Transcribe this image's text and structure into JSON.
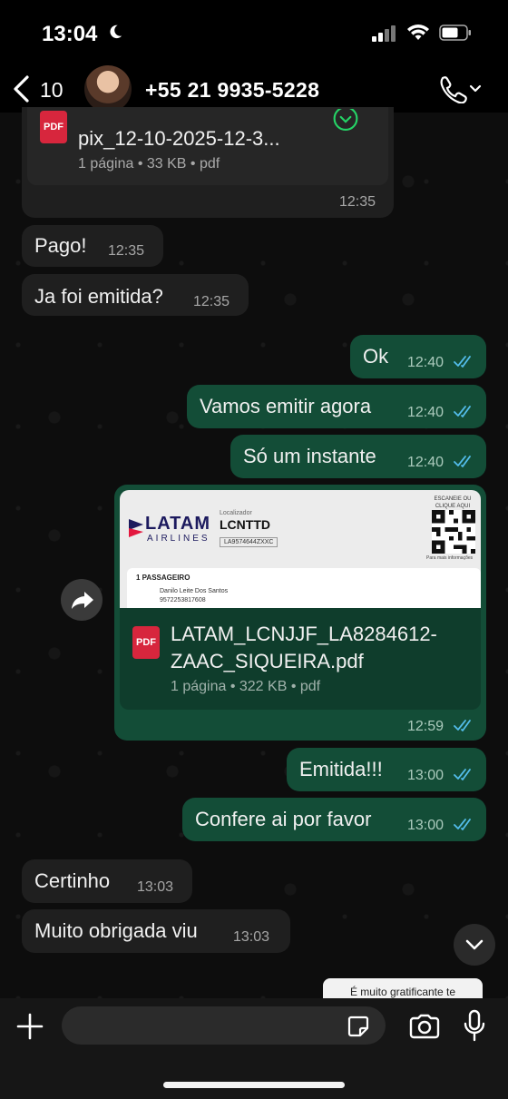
{
  "status_bar": {
    "time": "13:04",
    "icons": [
      "moon-icon",
      "signal-icon",
      "wifi-icon",
      "battery-icon"
    ]
  },
  "header": {
    "back_count": "10",
    "contact_name": "+55 21 9935-5228",
    "icons": [
      "chevron-left-icon",
      "avatar",
      "phone-icon",
      "chevron-down-icon"
    ]
  },
  "messages": [
    {
      "type": "document",
      "direction": "in",
      "badge": "PDF",
      "title": "pix_12-10-2025-12-3...",
      "meta": "1 página • 33 KB • pdf",
      "time": "12:35"
    },
    {
      "type": "text",
      "direction": "in",
      "text": "Pago!",
      "time": "12:35"
    },
    {
      "type": "text",
      "direction": "in",
      "text": "Ja foi emitida?",
      "time": "12:35"
    },
    {
      "type": "text",
      "direction": "out",
      "text": "Ok",
      "time": "12:40",
      "status": "read"
    },
    {
      "type": "text",
      "direction": "out",
      "text": "Vamos emitir agora",
      "time": "12:40",
      "status": "read"
    },
    {
      "type": "text",
      "direction": "out",
      "text": "Só um instante",
      "time": "12:40",
      "status": "read"
    },
    {
      "type": "document",
      "direction": "out",
      "badge": "PDF",
      "title_line1": "LATAM_LCNJJF_LA8284612-",
      "title_line2": "ZAAC_SIQUEIRA.pdf",
      "meta": "1 página • 322 KB • pdf",
      "time": "12:59",
      "status": "read",
      "preview": {
        "brand": "LATAM",
        "brand_sub": "AIRLINES",
        "locator_label": "Localizador",
        "locator_code": "LCNTTD",
        "locator_sub": "LA9574644ZXXC",
        "qr_label": "ESCANEIE OU CLIQUE AQUI",
        "qr_foot": "Para mais informações",
        "passengers_title": "1 PASSAGEIRO",
        "passenger_name": "Danilo Leite Dos Santos",
        "passenger_id": "9572253817608"
      }
    },
    {
      "type": "text",
      "direction": "out",
      "text": "Emitida!!!",
      "time": "13:00",
      "status": "read"
    },
    {
      "type": "text",
      "direction": "out",
      "text": "Confere ai por favor",
      "time": "13:00",
      "status": "read"
    },
    {
      "type": "text",
      "direction": "in",
      "text": "Certinho",
      "time": "13:03"
    },
    {
      "type": "text",
      "direction": "in",
      "text": "Muito obrigada viu",
      "time": "13:03"
    }
  ],
  "partial_reply_preview": "É muito gratificante te",
  "composer": {
    "value": "",
    "placeholder": "",
    "icons": [
      "plus-icon",
      "sticker-icon",
      "camera-icon",
      "mic-icon"
    ]
  },
  "colors": {
    "outgoing_bubble": "#134d37",
    "incoming_bubble": "#1f1f1f",
    "read_ticks": "#53bdeb",
    "pdf_badge": "#d7263d"
  }
}
